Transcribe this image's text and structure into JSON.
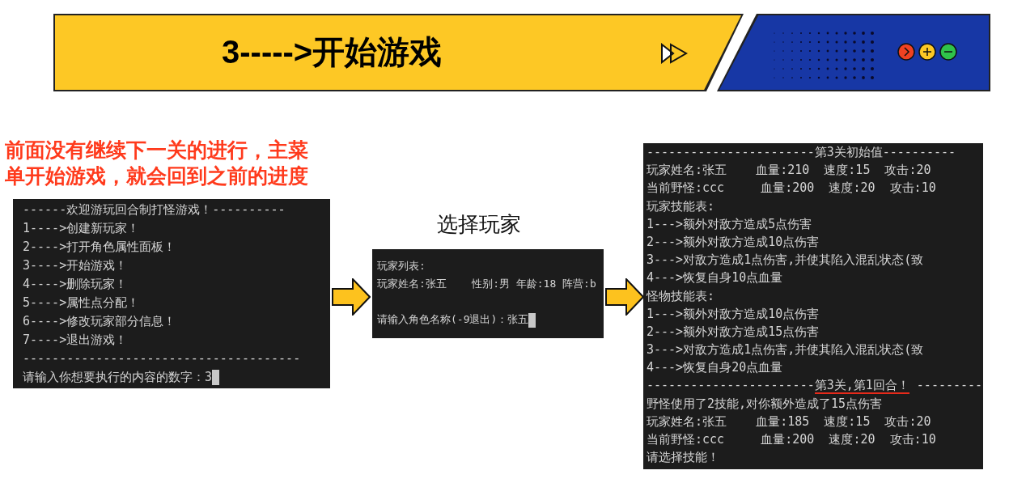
{
  "banner": {
    "title": "3----->开始游戏"
  },
  "note": "前面没有继续下一关的进行，主菜单开始游戏，就会回到之前的进度",
  "menu_console": {
    "header": "------欢迎游玩回合制打怪游戏！----------",
    "items": [
      "1---->创建新玩家！",
      "2---->打开角色属性面板！",
      "3---->开始游戏！",
      "4---->删除玩家！",
      "5---->属性点分配！",
      "6---->修改玩家部分信息！",
      "7---->退出游戏！"
    ],
    "divider": "--------------------------------------",
    "prompt": "请输入你想要执行的内容的数字：",
    "input": "3"
  },
  "select_label": "选择玩家",
  "player_console": {
    "lines": [
      "玩家列表:",
      "玩家姓名:张五    性别:男 年龄:18 阵营:b"
    ],
    "prompt": "请输入角色名称(-9退出)：",
    "input": "张五"
  },
  "battle_console": {
    "lines": [
      {
        "kind": "line",
        "text": "-----------------------第3关初始值----------"
      },
      {
        "kind": "line",
        "text": "玩家姓名:张五    血量:210  速度:15  攻击:20"
      },
      {
        "kind": "line",
        "text": "当前野怪:ccc     血量:200  速度:20  攻击:10"
      },
      {
        "kind": "line",
        "text": "玩家技能表:"
      },
      {
        "kind": "line",
        "text": "1--->额外对敌方造成5点伤害"
      },
      {
        "kind": "line",
        "text": "2--->额外对敌方造成10点伤害"
      },
      {
        "kind": "line",
        "text": "3--->对敌方造成1点伤害,并使其陷入混乱状态(致"
      },
      {
        "kind": "line",
        "text": "4--->恢复自身10点血量"
      },
      {
        "kind": "line",
        "text": "怪物技能表:"
      },
      {
        "kind": "line",
        "text": "1--->额外对敌方造成10点伤害"
      },
      {
        "kind": "line",
        "text": "2--->额外对敌方造成15点伤害"
      },
      {
        "kind": "line",
        "text": "3--->对敌方造成1点伤害,并使其陷入混乱状态(致"
      },
      {
        "kind": "line",
        "text": "4--->恢复自身20点血量"
      },
      {
        "kind": "marked",
        "before": "-----------------------",
        "text": "第3关,第1回合！",
        "after": " ---------"
      },
      {
        "kind": "line",
        "text": "野怪使用了2技能,对你额外造成了15点伤害"
      },
      {
        "kind": "line",
        "text": "玩家姓名:张五    血量:185  速度:15  攻击:20"
      },
      {
        "kind": "line",
        "text": "当前野怪:ccc     血量:200  速度:20  攻击:10"
      },
      {
        "kind": "line",
        "text": "请选择技能！"
      }
    ]
  }
}
